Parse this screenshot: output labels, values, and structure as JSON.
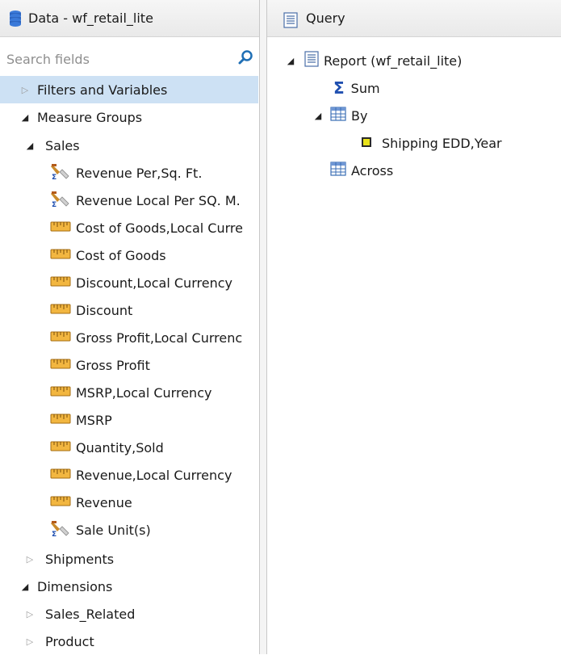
{
  "left_header": {
    "title": "Data - wf_retail_lite",
    "icon": "database-icon"
  },
  "search": {
    "placeholder": "Search fields",
    "icon": "search-icon"
  },
  "tree": {
    "filters": "Filters and Variables",
    "measure_groups": "Measure Groups",
    "sales": "Sales",
    "measures": [
      "Revenue Per,Sq. Ft.",
      "Revenue Local Per SQ. M.",
      "Cost of Goods,Local Curre",
      "Cost of Goods",
      "Discount,Local Currency",
      "Discount",
      "Gross Profit,Local Currenc",
      "Gross Profit",
      "MSRP,Local Currency",
      "MSRP",
      "Quantity,Sold",
      "Revenue,Local Currency",
      "Revenue",
      "Sale Unit(s)"
    ],
    "shipments": "Shipments",
    "dimensions": "Dimensions",
    "sales_related": "Sales_Related",
    "product": "Product"
  },
  "right_header": {
    "title": "Query",
    "icon": "document-icon"
  },
  "query": {
    "report": "Report (wf_retail_lite)",
    "sum": "Sum",
    "by": "By",
    "by_field": "Shipping EDD,Year",
    "across": "Across"
  },
  "colors": {
    "selected_row": "#cde1f4",
    "search_icon": "#1f6fb5",
    "sigma": "#1f4fb0"
  }
}
